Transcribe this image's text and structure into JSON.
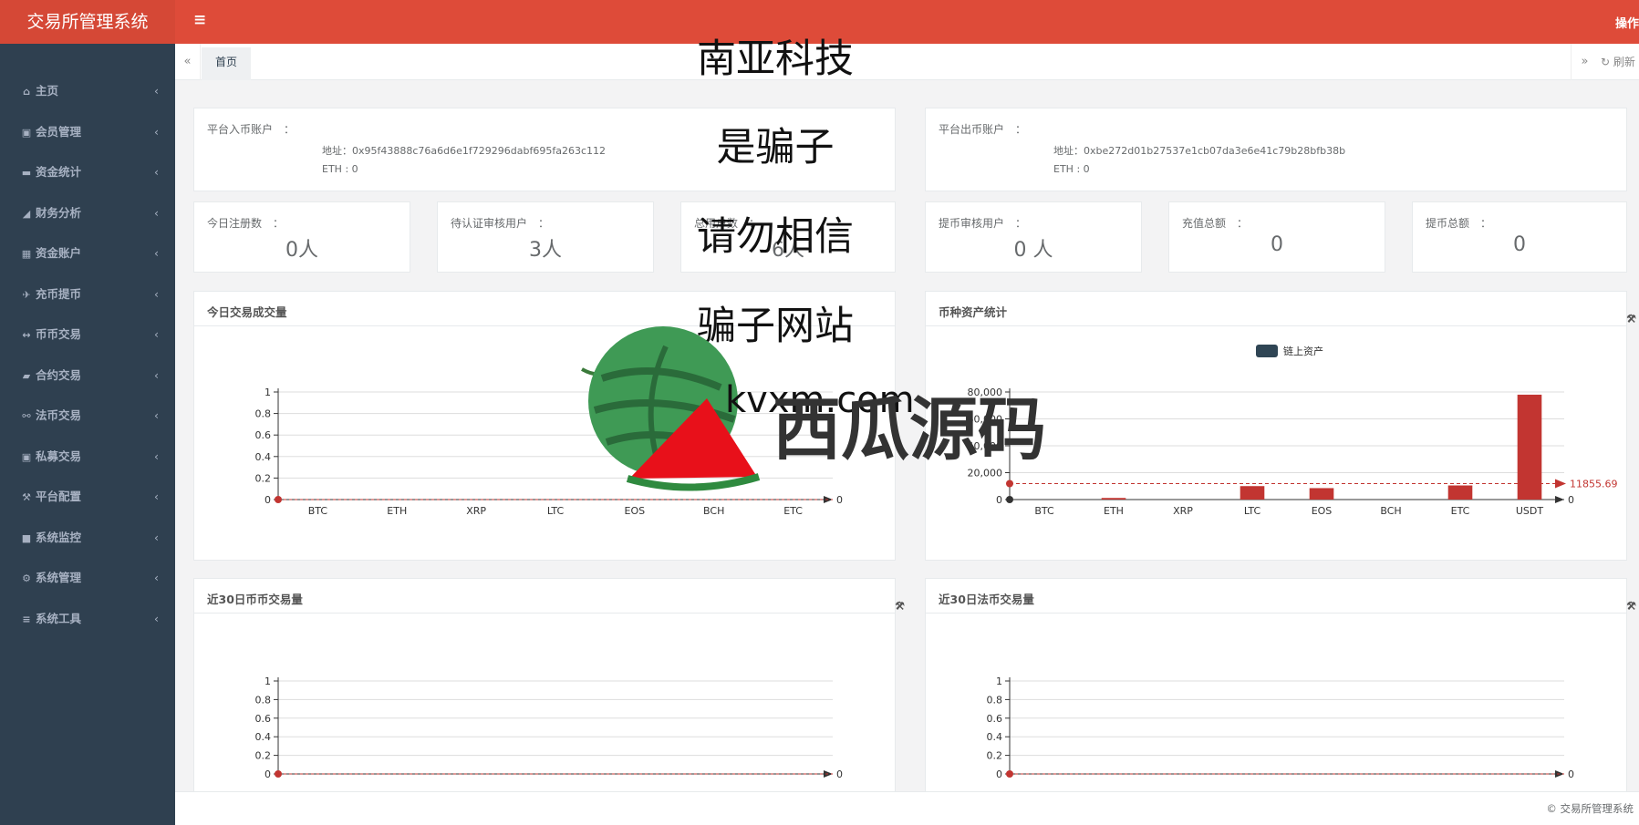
{
  "app": {
    "brand": "交易所管理系统",
    "top_action": "操作"
  },
  "sidebar": {
    "items": [
      {
        "icon": "home-icon",
        "glyph": "⌂",
        "label": "主页"
      },
      {
        "icon": "id-card-icon",
        "glyph": "▣",
        "label": "会员管理"
      },
      {
        "icon": "credit-card-icon",
        "glyph": "▬",
        "label": "资金统计"
      },
      {
        "icon": "area-chart-icon",
        "glyph": "◢",
        "label": "财务分析"
      },
      {
        "icon": "calculator-icon",
        "glyph": "▦",
        "label": "资金账户"
      },
      {
        "icon": "plane-icon",
        "glyph": "✈",
        "label": "充币提币"
      },
      {
        "icon": "exchange-icon",
        "glyph": "↔",
        "label": "币币交易"
      },
      {
        "icon": "book-icon",
        "glyph": "▰",
        "label": "合约交易"
      },
      {
        "icon": "handshake-icon",
        "glyph": "⚯",
        "label": "法币交易"
      },
      {
        "icon": "id-badge-icon",
        "glyph": "▣",
        "label": "私募交易"
      },
      {
        "icon": "wrench-icon",
        "glyph": "⚒",
        "label": "平台配置"
      },
      {
        "icon": "video-camera-icon",
        "glyph": "■",
        "label": "系统监控"
      },
      {
        "icon": "cog-icon",
        "glyph": "⚙",
        "label": "系统管理"
      },
      {
        "icon": "bars-icon",
        "glyph": "≡",
        "label": "系统工具"
      }
    ]
  },
  "tabs": {
    "home": "首页",
    "refresh": "刷新"
  },
  "accounts": {
    "in": {
      "label": "平台入币账户　：",
      "address": "地址：0x95f43888c76a6d6e1f729296dabf695fa263c112",
      "eth": "ETH : 0"
    },
    "out": {
      "label": "平台出币账户　：",
      "address": "地址：0xbe272d01b27537e1cb07da3e6e41c79b28bfb38b",
      "eth": "ETH : 0"
    }
  },
  "stats": [
    {
      "label": "今日注册数　：",
      "value": "0人"
    },
    {
      "label": "待认证审核用户　：",
      "value": "3人"
    },
    {
      "label": "总用户数　：",
      "value": "6人"
    },
    {
      "label": "提币审核用户　：",
      "value": "0 人"
    },
    {
      "label": "充值总额　：",
      "value": "0"
    },
    {
      "label": "提币总额　：",
      "value": "0"
    }
  ],
  "panels": {
    "today_volume": {
      "title": "今日交易成交量"
    },
    "asset_stats": {
      "title": "币种资产统计",
      "legend": "链上资产"
    },
    "coin_30d": {
      "title": "近30日币币交易量"
    },
    "fiat_30d": {
      "title": "近30日法币交易量"
    }
  },
  "chart_data": [
    {
      "type": "line",
      "title": "今日交易成交量",
      "categories": [
        "BTC",
        "ETH",
        "XRP",
        "LTC",
        "EOS",
        "BCH",
        "ETC"
      ],
      "values": [
        0,
        0,
        0,
        0,
        0,
        0,
        0
      ],
      "ylim": [
        0,
        1
      ],
      "yticks": [
        "0",
        "0.2",
        "0.4",
        "0.6",
        "0.8",
        "1"
      ],
      "end_label": "0",
      "grid": true
    },
    {
      "type": "bar",
      "title": "币种资产统计",
      "categories": [
        "BTC",
        "ETH",
        "XRP",
        "LTC",
        "EOS",
        "BCH",
        "ETC",
        "USDT"
      ],
      "series": [
        {
          "name": "链上资产",
          "values": [
            0,
            1200,
            0,
            10000,
            8500,
            0,
            10500,
            78000
          ]
        }
      ],
      "ylim": [
        0,
        80000
      ],
      "yticks": [
        "0",
        "20,000",
        "40,000",
        "60,000",
        "80,000"
      ],
      "mark_line": {
        "value": 11855.69,
        "label": "11855.69"
      },
      "end_label": "0",
      "legend_position": "top",
      "grid": true
    },
    {
      "type": "line",
      "title": "近30日币币交易量",
      "categories": [],
      "values": [
        0
      ],
      "ylim": [
        0,
        1
      ],
      "yticks": [
        "0",
        "0.2",
        "0.4",
        "0.6",
        "0.8",
        "1"
      ],
      "end_label": "0",
      "grid": true
    },
    {
      "type": "line",
      "title": "近30日法币交易量",
      "categories": [],
      "values": [
        0
      ],
      "ylim": [
        0,
        1
      ],
      "yticks": [
        "0",
        "0.2",
        "0.4",
        "0.6",
        "0.8",
        "1"
      ],
      "end_label": "0",
      "grid": true
    }
  ],
  "watermark": {
    "lines": [
      "南亚科技",
      "是骗子",
      "请勿相信",
      "骗子网站"
    ],
    "site": "kvxm.com",
    "brand": "西瓜源码"
  },
  "footer": {
    "text": "© 交易所管理系统"
  },
  "colors": {
    "topbar": "#de4b39",
    "sidebar": "#2f4050",
    "bar": "#c23531",
    "legend": "#2f4554"
  }
}
